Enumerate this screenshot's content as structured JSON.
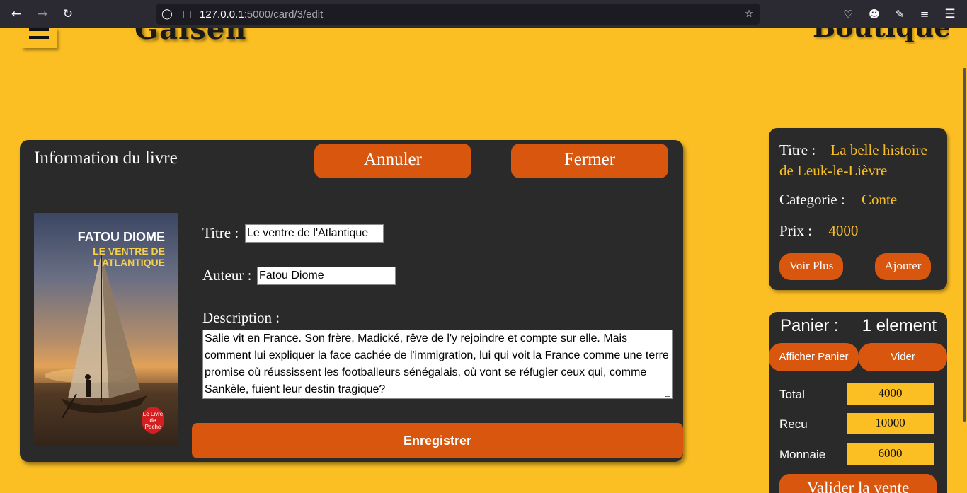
{
  "browser": {
    "url_host": "127.0.0.1",
    "url_rest": ":5000/card/3/edit"
  },
  "header": {
    "site_title": "Galsen BookStore",
    "boutique": "Boutique"
  },
  "edit_card": {
    "title": "Information du livre",
    "cancel_label": "Annuler",
    "close_label": "Fermer",
    "cover": {
      "author": "FATOU DIOME",
      "title": "LE VENTRE DE L'ATLANTIQUE",
      "publisher": "Le Livre de Poche"
    },
    "titre_label": "Titre :",
    "titre_value": "Le ventre de l'Atlantique",
    "auteur_label": "Auteur :",
    "auteur_value": "Fatou Diome",
    "description_label": "Description :",
    "description_value": "Salie vit en France. Son frère, Madické, rêve de l'y rejoindre et compte sur elle. Mais comment lui expliquer la face cachée de l'immigration, lui qui voit la France comme une terre promise où réussissent les footballeurs sénégalais, où vont se réfugier ceux qui, comme Sankèle, fuient leur destin tragique?",
    "save_label": "Enregistrer"
  },
  "info_card": {
    "titre_label": "Titre :",
    "titre_value": "La belle histoire de Leuk-le-Lièvre",
    "categorie_label": "Categorie :",
    "categorie_value": "Conte",
    "prix_label": "Prix :",
    "prix_value": "4000",
    "voir_plus": "Voir Plus",
    "ajouter": "Ajouter"
  },
  "panier": {
    "label": "Panier :",
    "count": "1 element",
    "afficher": "Afficher Panier",
    "vider": "Vider",
    "total_label": "Total",
    "total_value": "4000",
    "recu_label": "Recu",
    "recu_value": "10000",
    "monnaie_label": "Monnaie",
    "monnaie_value": "6000",
    "valider": "Valider la vente"
  },
  "colors": {
    "page_bg": "#fbbf24",
    "card_bg": "#2a2a2a",
    "accent": "#d9560f"
  }
}
